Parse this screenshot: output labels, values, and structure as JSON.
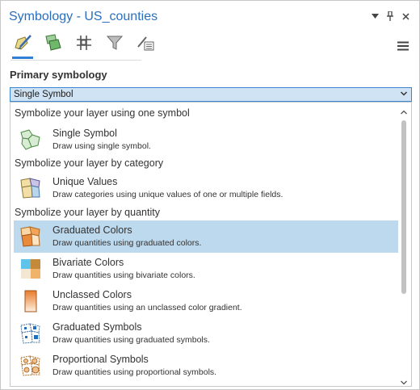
{
  "window": {
    "title": "Symbology - US_counties"
  },
  "pane_buttons": [
    "chevron-down-icon",
    "pin-icon",
    "close-icon"
  ],
  "toolbar": {
    "tools": [
      {
        "name": "primary-symbology-tab",
        "icon": "polygon-brush-icon",
        "active": true
      },
      {
        "name": "vary-symbology-tab",
        "icon": "polygon-layers-icon",
        "active": false
      },
      {
        "name": "symbol-layer-drawing-tab",
        "icon": "grid-hash-icon",
        "active": false
      },
      {
        "name": "symbology-filter-tab",
        "icon": "funnel-icon",
        "active": false
      },
      {
        "name": "additional-symbology-tab",
        "icon": "pencil-list-icon",
        "active": false
      }
    ],
    "menu_icon": "hamburger-menu-icon"
  },
  "primary": {
    "label": "Primary symbology",
    "selected": "Single Symbol"
  },
  "dropdown": {
    "groups": [
      {
        "title": "Symbolize your layer using one symbol"
      },
      {
        "title": "Symbolize your layer by category"
      },
      {
        "title": "Symbolize your layer by quantity"
      }
    ],
    "items": [
      {
        "name": "Single Symbol",
        "desc": "Draw using single symbol.",
        "icon": "single-symbol-icon"
      },
      {
        "name": "Unique Values",
        "desc": "Draw categories using unique values of one or multiple fields.",
        "icon": "unique-values-icon"
      },
      {
        "name": "Graduated Colors",
        "desc": "Draw quantities using graduated colors.",
        "icon": "graduated-colors-icon",
        "selected": true
      },
      {
        "name": "Bivariate Colors",
        "desc": "Draw quantities using bivariate colors.",
        "icon": "bivariate-colors-icon"
      },
      {
        "name": "Unclassed Colors",
        "desc": "Draw quantities using an unclassed color gradient.",
        "icon": "unclassed-colors-icon"
      },
      {
        "name": "Graduated Symbols",
        "desc": "Draw quantities using graduated symbols.",
        "icon": "graduated-symbols-icon"
      },
      {
        "name": "Proportional Symbols",
        "desc": "Draw quantities using proportional symbols.",
        "icon": "proportional-symbols-icon"
      }
    ]
  },
  "colors": {
    "accent": "#2f7fd4",
    "title": "#2a6fbf",
    "selected_row": "#bcd9ee",
    "select_bg": "#cfe3f5"
  }
}
